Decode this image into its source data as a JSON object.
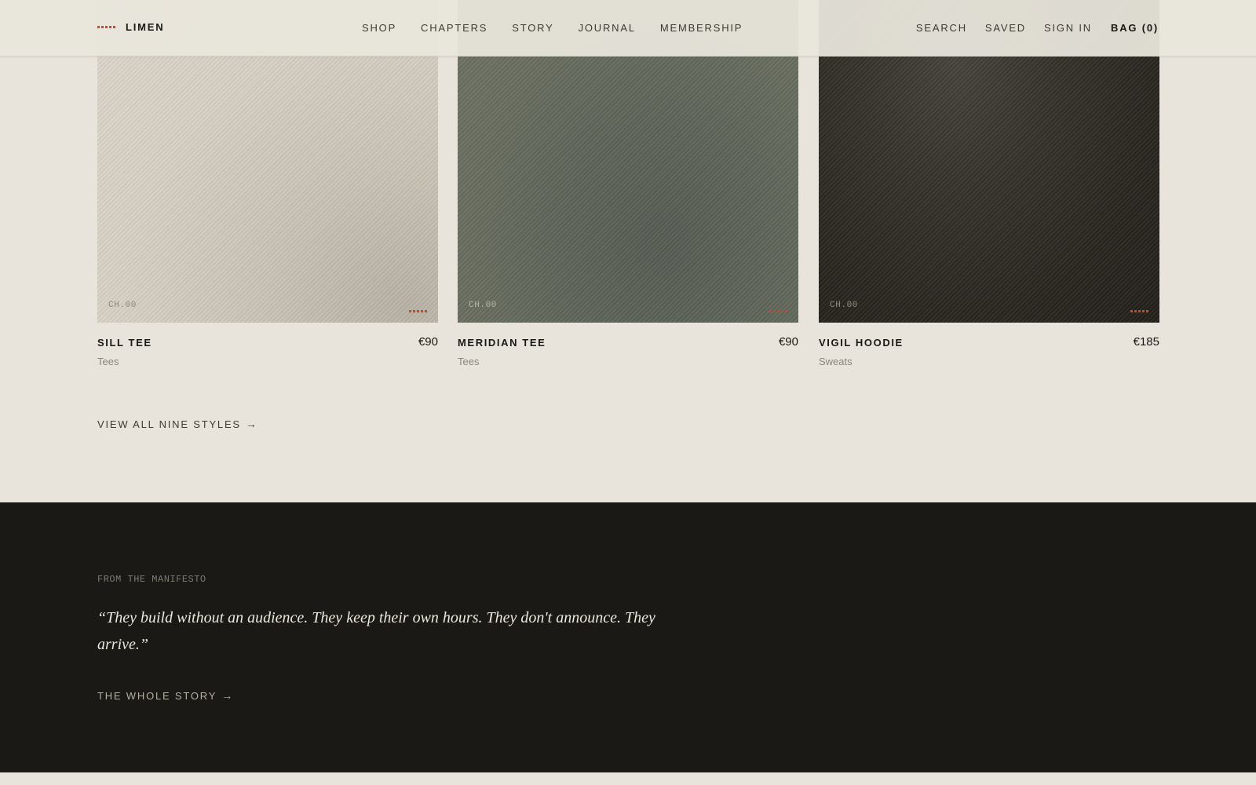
{
  "brand": {
    "name": "LIMEN",
    "accent": "#b8512d"
  },
  "nav": {
    "main": [
      "SHOP",
      "CHAPTERS",
      "STORY",
      "JOURNAL",
      "MEMBERSHIP"
    ],
    "utility": {
      "search": "SEARCH",
      "saved": "SAVED",
      "sign_in": "SIGN IN",
      "bag": "BAG (0)"
    }
  },
  "products": [
    {
      "chapter": "CH.00",
      "name": "SILL TEE",
      "price": "€90",
      "category": "Tees",
      "swatch": "#d6cfc2"
    },
    {
      "chapter": "CH.00",
      "name": "MERIDIAN TEE",
      "price": "€90",
      "category": "Tees",
      "swatch": "#62685b"
    },
    {
      "chapter": "CH.00",
      "name": "VIGIL HOODIE",
      "price": "€185",
      "category": "Sweats",
      "swatch": "#2c2923"
    }
  ],
  "view_all": {
    "label": "VIEW ALL NINE STYLES",
    "arrow": "→"
  },
  "manifesto": {
    "eyebrow": "FROM THE MANIFESTO",
    "quote": "“They build without an audience. They keep their own hours. They don't announce. They arrive.”",
    "link_label": "THE WHOLE STORY",
    "arrow": "→",
    "background": "#1b1915"
  }
}
